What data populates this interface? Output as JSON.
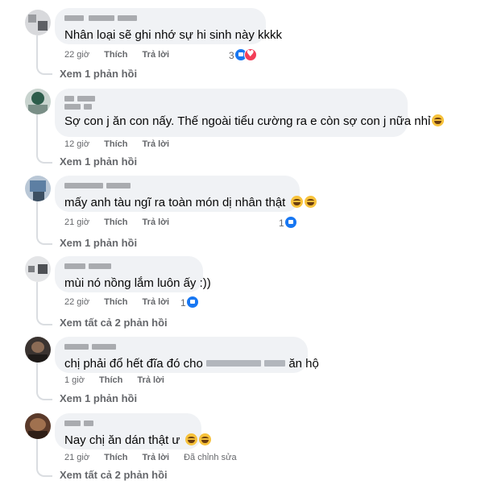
{
  "comments": [
    {
      "text": "Nhân loại sẽ ghi nhớ sự hi sinh này kkkk",
      "time": "22 giờ",
      "like": "Thích",
      "reply": "Trả lời",
      "reaction_count": "3",
      "view_replies": "Xem 1 phản hồi"
    },
    {
      "text": "Sợ con j ăn con nấy. Thế ngoài tiểu cường ra e còn sợ con j nữa nhỉ",
      "time": "12 giờ",
      "like": "Thích",
      "reply": "Trả lời",
      "view_replies": "Xem 1 phản hồi"
    },
    {
      "text": "mấy anh tàu ngĩ ra toàn món dị nhân thật",
      "time": "21 giờ",
      "like": "Thích",
      "reply": "Trả lời",
      "reaction_count": "1",
      "view_replies": "Xem 1 phản hồi"
    },
    {
      "text": "mùi nó nồng lắm luôn ấy :))",
      "time": "22 giờ",
      "like": "Thích",
      "reply": "Trả lời",
      "reaction_count": "1",
      "view_replies": "Xem tất cả 2 phản hồi"
    },
    {
      "text_before": "chị phải đổ hết đĩa đó cho",
      "text_after": "ăn hộ",
      "time": "1 giờ",
      "like": "Thích",
      "reply": "Trả lời",
      "view_replies": "Xem 1 phản hồi"
    },
    {
      "text": "Nay chị ăn dán thật ư",
      "time": "21 giờ",
      "like": "Thích",
      "reply": "Trả lời",
      "edited": "Đã chỉnh sửa",
      "view_replies": "Xem tất cả 2 phản hồi"
    }
  ],
  "icons": {
    "like": "like-icon",
    "love": "heart-icon",
    "laugh": "laughing-emoji-icon"
  },
  "colors": {
    "bubble": "#f0f2f5",
    "meta": "#65676b",
    "like_blue": "#1877f2",
    "love_red": "#f33e58"
  }
}
